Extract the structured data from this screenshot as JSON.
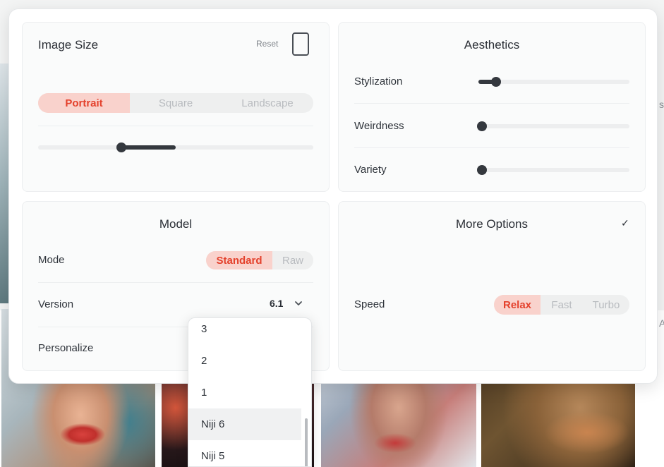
{
  "background": {
    "right_edge_text": [
      "s",
      "A"
    ]
  },
  "image_size": {
    "title": "Image Size",
    "reset_label": "Reset",
    "orientation_options": [
      "Portrait",
      "Square",
      "Landscape"
    ],
    "selected_orientation": "Portrait",
    "ratio_slider_range": [
      0.3,
      0.5
    ]
  },
  "aesthetics": {
    "title": "Aesthetics",
    "sliders": [
      {
        "label": "Stylization",
        "value": 0.08
      },
      {
        "label": "Weirdness",
        "value": 0.0
      },
      {
        "label": "Variety",
        "value": 0.0
      }
    ]
  },
  "model": {
    "title": "Model",
    "mode_label": "Mode",
    "mode_options": [
      "Standard",
      "Raw"
    ],
    "selected_mode": "Standard",
    "version_label": "Version",
    "version_value": "6.1",
    "personalize_label": "Personalize",
    "version_menu": {
      "options": [
        "3",
        "2",
        "1",
        "Niji 6",
        "Niji 5"
      ],
      "highlighted": "Niji 6"
    }
  },
  "more_options": {
    "title": "More Options",
    "check_icon": "✓",
    "speed_label": "Speed",
    "speed_options": [
      "Relax",
      "Fast",
      "Turbo"
    ],
    "selected_speed": "Relax"
  },
  "colors": {
    "accent_bg": "#f9d2cc",
    "accent_text": "#e4412c",
    "slider_dark": "#34383e"
  },
  "icons": [
    "portrait-aspect-icon",
    "chevron-down-icon",
    "check-icon"
  ]
}
